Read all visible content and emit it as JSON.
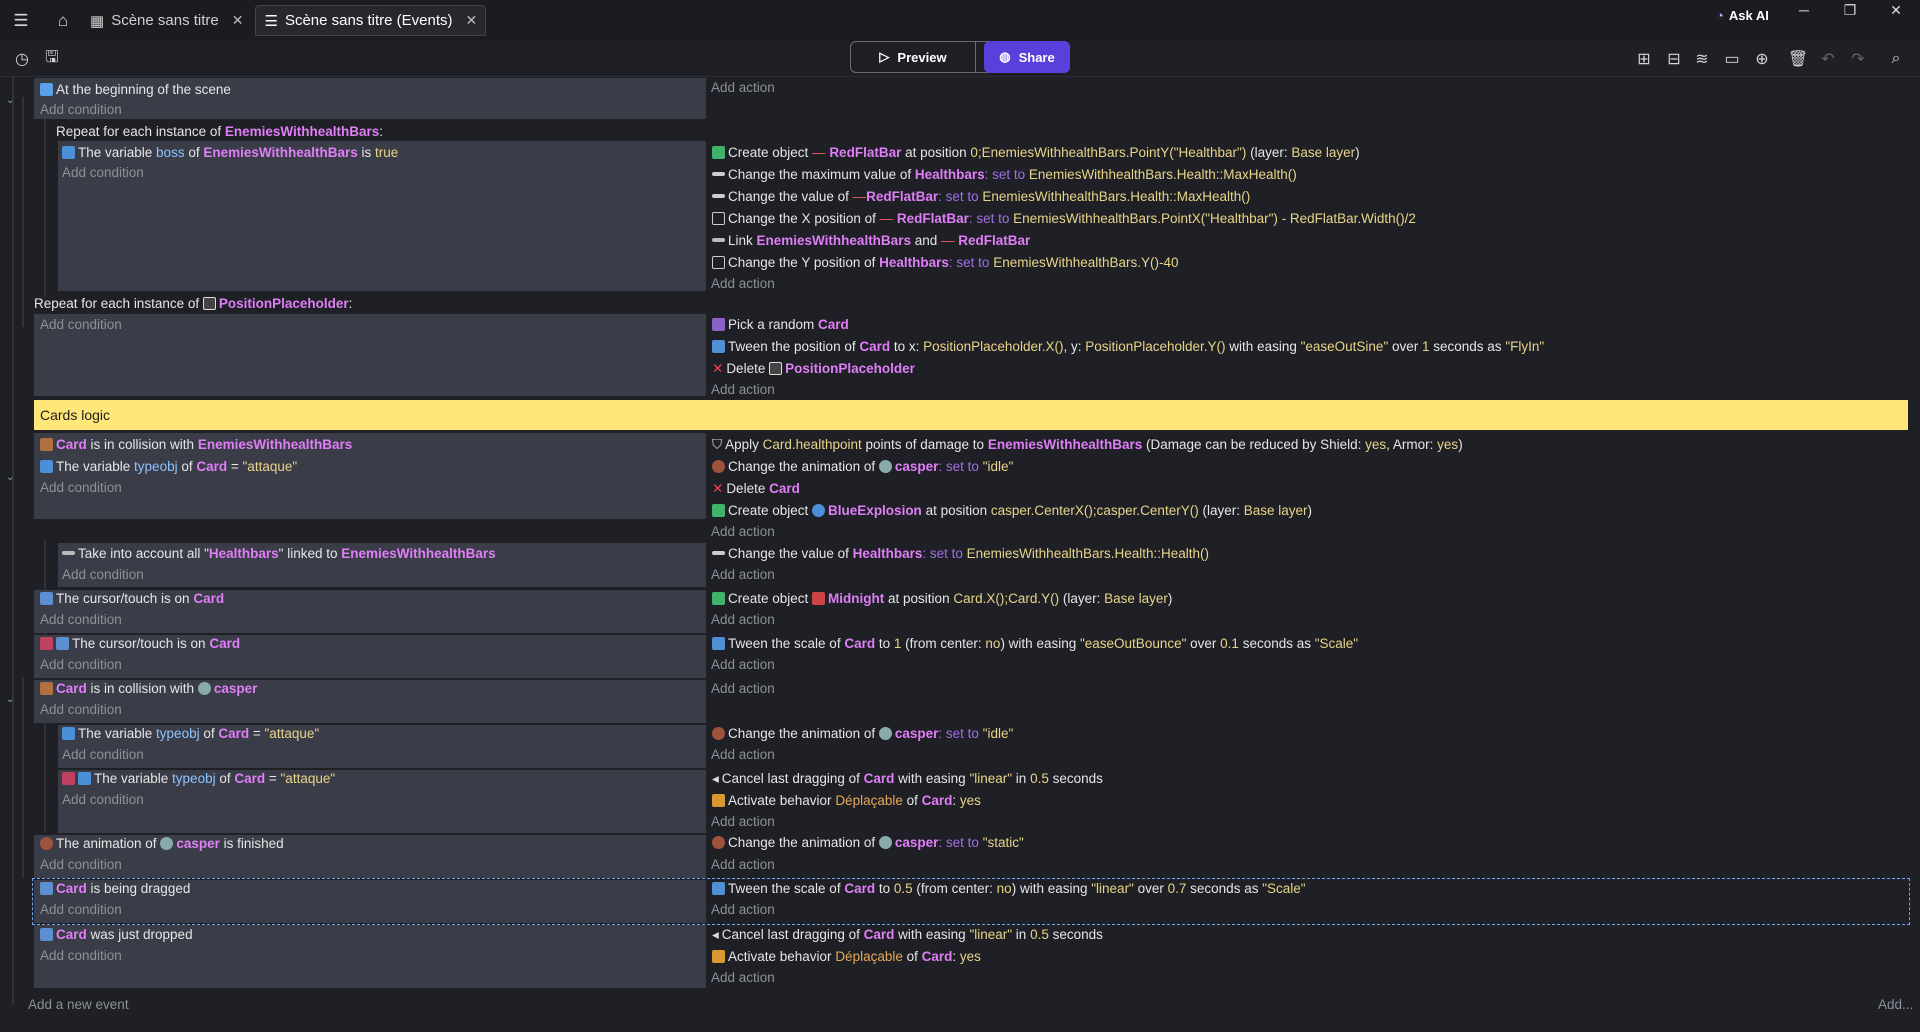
{
  "tabs": [
    {
      "label": "Scène sans titre"
    },
    {
      "label": "Scène sans titre (Events)"
    }
  ],
  "header": {
    "ask_ai": "Ask AI",
    "preview": "Preview",
    "share": "Share"
  },
  "labels": {
    "add_condition": "Add condition",
    "add_action": "Add action",
    "add_event": "Add a new event",
    "add_more": "Add..."
  },
  "comment": "Cards logic",
  "events": {
    "e1_cond": "At the beginning of the scene",
    "e2_repeat_prefix": "Repeat for each instance of ",
    "e2_repeat_obj": "EnemiesWithhealthBars",
    "e2_cond_a": "The variable ",
    "e2_cond_b": "boss",
    "e2_cond_c": " of ",
    "e2_cond_d": "EnemiesWithhealthBars",
    "e2_cond_e": " is ",
    "e2_cond_f": "true",
    "e2_a1": "Create object ",
    "e2_a1o": "RedFlatBar",
    "e2_a1b": " at position ",
    "e2_a1v": "0;EnemiesWithhealthBars.PointY(\"Healthbar\")",
    "e2_a1c": " (layer: ",
    "e2_a1l": "Base layer",
    "e2_a1d": ")",
    "e2_a2": "Change the maximum value of ",
    "e2_a2o": "Healthbars",
    "e2_a2k": ": set to ",
    "e2_a2v": "EnemiesWithhealthBars.Health::MaxHealth()",
    "e2_a3": "Change the value of ",
    "e2_a3o": "RedFlatBar",
    "e2_a3k": ": set to ",
    "e2_a3v": "EnemiesWithhealthBars.Health::MaxHealth()",
    "e2_a4": "Change the X position of ",
    "e2_a4o": "RedFlatBar",
    "e2_a4k": ": set to ",
    "e2_a4v": "EnemiesWithhealthBars.PointX(\"Healthbar\") - RedFlatBar.Width()/2",
    "e2_a5": "Link ",
    "e2_a5o": "EnemiesWithhealthBars",
    "e2_a5b": " and ",
    "e2_a5p": "RedFlatBar",
    "e2_a6": "Change the Y position of ",
    "e2_a6o": "Healthbars",
    "e2_a6k": ": set to ",
    "e2_a6v": "EnemiesWithhealthBars.Y()-40",
    "e3_repeat_prefix": "Repeat for each instance of ",
    "e3_repeat_obj": "PositionPlaceholder",
    "e3_a1": "Pick a random ",
    "e3_a1o": "Card",
    "e3_a2": "Tween the position of ",
    "e3_a2o": "Card",
    "e3_a2b": " to x: ",
    "e3_a2v1": "PositionPlaceholder.X()",
    "e3_a2c": ", y: ",
    "e3_a2v2": "PositionPlaceholder.Y()",
    "e3_a2d": " with easing ",
    "e3_a2s": "\"easeOutSine\"",
    "e3_a2e": " over ",
    "e3_a2n": "1",
    "e3_a2f": " seconds as ",
    "e3_a2t": "\"FlyIn\"",
    "e3_a3": "Delete ",
    "e3_a3o": "PositionPlaceholder",
    "e4_c1o": "Card",
    "e4_c1": " is in collision with ",
    "e4_c1p": "EnemiesWithhealthBars",
    "e4_c2": "The variable ",
    "e4_c2v": "typeobj",
    "e4_c2b": " of ",
    "e4_c2o": "Card",
    "e4_c2e": " = ",
    "e4_c2s": "\"attaque\"",
    "e4_a1": "Apply ",
    "e4_a1v": "Card.healthpoint",
    "e4_a1b": " points of damage to ",
    "e4_a1o": "EnemiesWithhealthBars",
    "e4_a1c": " (Damage can be reduced by Shield: ",
    "e4_a1y": "yes",
    "e4_a1d": ", Armor: ",
    "e4_a1z": "yes",
    "e4_a1e": ")",
    "e4_a2": "Change the animation of ",
    "e4_a2o": "casper",
    "e4_a2k": ": set to ",
    "e4_a2s": "\"idle\"",
    "e4_a3": "Delete ",
    "e4_a3o": "Card",
    "e4_a4": "Create object ",
    "e4_a4o": "BlueExplosion",
    "e4_a4b": " at position ",
    "e4_a4v": "casper.CenterX();casper.CenterY()",
    "e4_a4c": " (layer: ",
    "e4_a4l": "Base layer",
    "e4_a4d": ")",
    "e5_c1": "Take into account all \"",
    "e5_c1o": "Healthbars",
    "e5_c1b": "\" linked to ",
    "e5_c1p": "EnemiesWithhealthBars",
    "e5_a1": "Change the value of ",
    "e5_a1o": "Healthbars",
    "e5_a1k": ": set to ",
    "e5_a1v": "EnemiesWithhealthBars.Health::Health()",
    "e6_c1": "The cursor/touch is on ",
    "e6_c1o": "Card",
    "e6_a1": "Create object ",
    "e6_a1o": "Midnight",
    "e6_a1b": " at position ",
    "e6_a1v": "Card.X();Card.Y()",
    "e6_a1c": " (layer: ",
    "e6_a1l": "Base layer",
    "e6_a1d": ")",
    "e7_c1": "The cursor/touch is on ",
    "e7_c1o": "Card",
    "e7_a1": "Tween the scale of ",
    "e7_a1o": "Card",
    "e7_a1b": " to ",
    "e7_a1n": "1",
    "e7_a1c": " (from center: ",
    "e7_a1y": "no",
    "e7_a1d": ") with easing ",
    "e7_a1s": "\"easeOutBounce\"",
    "e7_a1e": " over ",
    "e7_a1m": "0.1",
    "e7_a1f": " seconds as ",
    "e7_a1t": "\"Scale\"",
    "e8_c1o": "Card",
    "e8_c1": " is in collision with ",
    "e8_c1p": "casper",
    "e9_c1": "The variable ",
    "e9_c1v": "typeobj",
    "e9_c1b": " of ",
    "e9_c1o": "Card",
    "e9_c1e": " = ",
    "e9_c1s": "\"attaque\"",
    "e9_a1": "Change the animation of ",
    "e9_a1o": "casper",
    "e9_a1k": ": set to ",
    "e9_a1s": "\"idle\"",
    "e10_c1": "The variable ",
    "e10_c1v": "typeobj",
    "e10_c1b": " of ",
    "e10_c1o": "Card",
    "e10_c1e": " = ",
    "e10_c1s": "\"attaque\"",
    "e10_a1": "Cancel last dragging of ",
    "e10_a1o": "Card",
    "e10_a1b": " with easing ",
    "e10_a1s": "\"linear\"",
    "e10_a1c": " in ",
    "e10_a1n": "0.5",
    "e10_a1d": " seconds",
    "e10_a2": "Activate behavior ",
    "e10_a2b": "Déplaçable",
    "e10_a2c": " of ",
    "e10_a2o": "Card",
    "e10_a2d": ": ",
    "e10_a2y": "yes",
    "e11_c1": "The animation of ",
    "e11_c1o": "casper",
    "e11_c1b": " is finished",
    "e11_a1": "Change the animation of ",
    "e11_a1o": "casper",
    "e11_a1k": ": set to ",
    "e11_a1s": "\"static\"",
    "e12_c1o": "Card",
    "e12_c1": " is being dragged",
    "e12_a1": "Tween the scale of ",
    "e12_a1o": "Card",
    "e12_a1b": " to ",
    "e12_a1n": "0.5",
    "e12_a1c": " (from center: ",
    "e12_a1y": "no",
    "e12_a1d": ") with easing ",
    "e12_a1s": "\"linear\"",
    "e12_a1e": " over ",
    "e12_a1m": "0.7",
    "e12_a1f": " seconds as ",
    "e12_a1t": "\"Scale\"",
    "e13_c1o": "Card",
    "e13_c1": " was just dropped",
    "e13_a1": "Cancel last dragging of ",
    "e13_a1o": "Card",
    "e13_a1b": " with easing ",
    "e13_a1s": "\"linear\"",
    "e13_a1c": " in ",
    "e13_a1n": "0.5",
    "e13_a1d": " seconds",
    "e13_a2": "Activate behavior ",
    "e13_a2b": "Déplaçable",
    "e13_a2c": " of ",
    "e13_a2o": "Card",
    "e13_a2d": ": ",
    "e13_a2y": "yes"
  },
  "colors": {
    "object": "#e07ef7",
    "value": "#e9d489",
    "keyword": "#a16ee8",
    "comment_bg": "#ffe678",
    "share": "#5b3fdc"
  }
}
